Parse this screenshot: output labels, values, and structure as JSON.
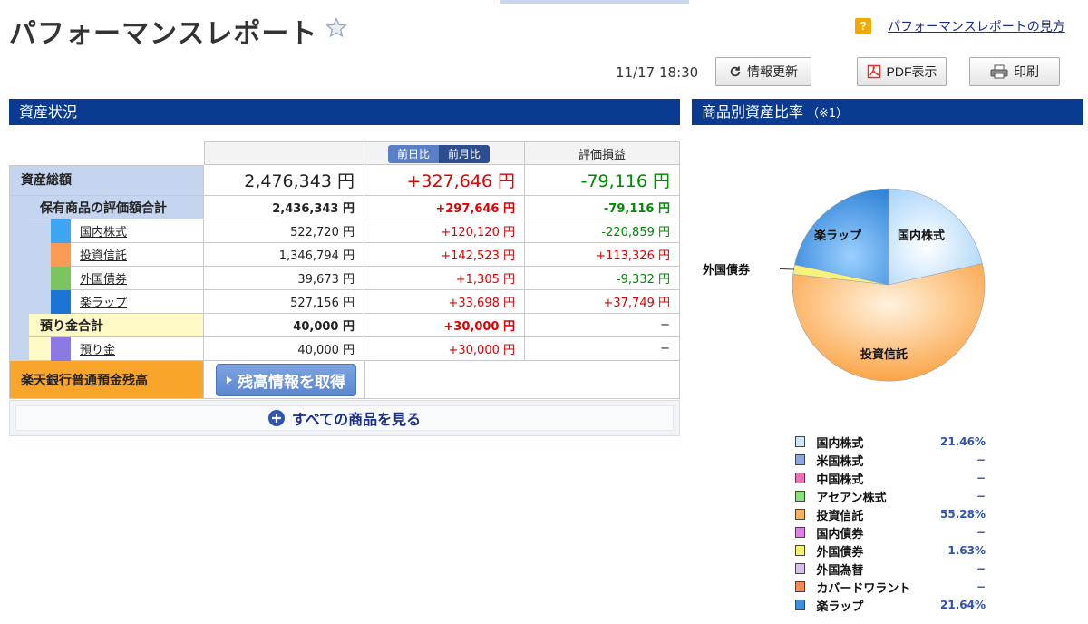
{
  "header": {
    "title": "パフォーマンスレポート",
    "help_icon_text": "?",
    "help_link": "パフォーマンスレポートの見方"
  },
  "toolbar": {
    "timestamp": "11/17 18:30",
    "refresh_label": "情報更新",
    "pdf_label": "PDF表示",
    "print_label": "印刷"
  },
  "assets_section": {
    "title": "資産状況",
    "segment": [
      "前日比",
      "前月比"
    ],
    "col_eval": "評価損益",
    "total": {
      "label": "資産総額",
      "amount": "2,476,343 円",
      "diff": "+327,646 円",
      "pl": "-79,116 円"
    },
    "holdings_total": {
      "label": "保有商品の評価額合計",
      "amount": "2,436,343 円",
      "diff": "+297,646 円",
      "pl": "-79,116 円"
    },
    "holdings": [
      {
        "name": "国内株式",
        "amount": "522,720 円",
        "diff": "+120,120 円",
        "pl": "-220,859 円",
        "color": "#3ea5f5"
      },
      {
        "name": "投資信託",
        "amount": "1,346,794 円",
        "diff": "+142,523 円",
        "pl": "+113,326 円",
        "color": "#fb9a55"
      },
      {
        "name": "外国債券",
        "amount": "39,673 円",
        "diff": "+1,305 円",
        "pl": "-9,332 円",
        "color": "#7cc45e"
      },
      {
        "name": "楽ラップ",
        "amount": "527,156 円",
        "diff": "+33,698 円",
        "pl": "+37,749 円",
        "color": "#1a74d6"
      }
    ],
    "deposit_total": {
      "label": "預り金合計",
      "amount": "40,000 円",
      "diff": "+30,000 円",
      "pl": "−"
    },
    "deposit": {
      "name": "預り金",
      "amount": "40,000 円",
      "diff": "+30,000 円",
      "pl": "−",
      "color": "#8c79e6"
    },
    "bank": {
      "label": "楽天銀行普通預金残高",
      "button": "残高情報を取得"
    },
    "all_products": "すべての商品を見る"
  },
  "ratio_section": {
    "title": "商品別資産比率",
    "note": "（※1）",
    "pie_labels": {
      "domestic": "国内株式",
      "fund": "投資信託",
      "foreign_bond": "外国債券",
      "wrap": "楽ラップ"
    },
    "legend": [
      {
        "name": "国内株式",
        "value": "21.46%",
        "color": "#cfe6fb"
      },
      {
        "name": "米国株式",
        "value": "−",
        "color": "#8ea6e0"
      },
      {
        "name": "中国株式",
        "value": "−",
        "color": "#f070b8"
      },
      {
        "name": "アセアン株式",
        "value": "−",
        "color": "#8be07a"
      },
      {
        "name": "投資信託",
        "value": "55.28%",
        "color": "#fbb060"
      },
      {
        "name": "国内債券",
        "value": "−",
        "color": "#e080e8"
      },
      {
        "name": "外国債券",
        "value": "1.63%",
        "color": "#f5f070"
      },
      {
        "name": "外国為替",
        "value": "−",
        "color": "#d7c0f0"
      },
      {
        "name": "カバードワラント",
        "value": "−",
        "color": "#f48a5a"
      },
      {
        "name": "楽ラップ",
        "value": "21.64%",
        "color": "#3a8fe0"
      }
    ]
  }
}
